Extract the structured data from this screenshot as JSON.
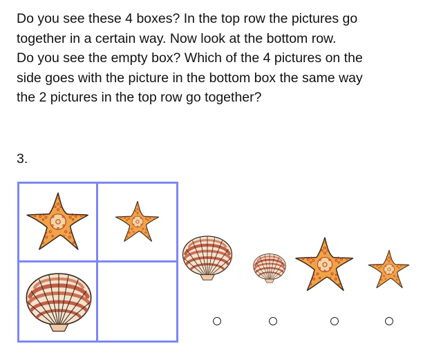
{
  "instructions": {
    "lines": [
      "Do you see these 4 boxes?  In the top row the pictures go",
      "together in a certain way.  Now look at the bottom row.",
      "Do you see the empty box?  Which of the 4 pictures on the",
      "side goes with the picture in the bottom box the same way",
      "the 2 pictures in the top row go together?"
    ]
  },
  "question": {
    "number": "3."
  },
  "grid": {
    "border_color": "#7d86f5",
    "top_left": "starfish-large",
    "top_right": "starfish-small",
    "bottom_left": "shell-large",
    "bottom_right": "empty"
  },
  "options": [
    {
      "picture": "shell-large"
    },
    {
      "picture": "shell-small"
    },
    {
      "picture": "starfish-large"
    },
    {
      "picture": "starfish-small"
    }
  ],
  "colors": {
    "starfish_fill": "#f2a345",
    "starfish_center": "#f5d4a0",
    "starfish_dots": "#b8452c",
    "shell_light": "#f6e2cc",
    "shell_band": "#b9462f",
    "outline": "#3a2a20"
  }
}
